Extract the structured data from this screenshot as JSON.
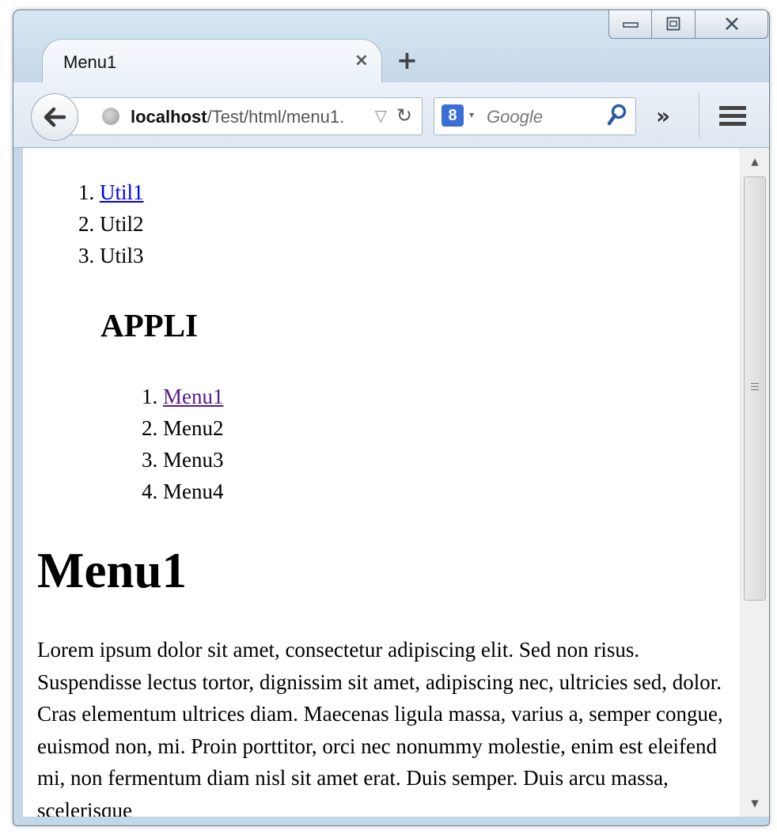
{
  "window": {
    "tab_title": "Menu1",
    "tab_close": "×",
    "new_tab": "+"
  },
  "toolbar": {
    "url_host": "localhost",
    "url_path": "/Test/html/menu1.",
    "url_dropdown": "▽",
    "reload": "↻",
    "search_engine_icon": "8",
    "search_dropdown": "▾",
    "search_placeholder": "Google",
    "overflow": "»"
  },
  "page": {
    "util_list": [
      "Util1",
      "Util2",
      "Util3"
    ],
    "section_heading": "APPLI",
    "menu_list": [
      "Menu1",
      "Menu2",
      "Menu3",
      "Menu4"
    ],
    "title": "Menu1",
    "paragraph": "Lorem ipsum dolor sit amet, consectetur adipiscing elit. Sed non risus. Suspendisse lectus tortor, dignissim sit amet, adipiscing nec, ultricies sed, dolor. Cras elementum ultrices diam. Maecenas ligula massa, varius a, semper congue, euismod non, mi. Proin porttitor, orci nec nonummy molestie, enim est eleifend mi, non fermentum diam nisl sit amet erat. Duis semper. Duis arcu massa, scelerisque"
  },
  "colors": {
    "link": "#0000ee",
    "visited_link": "#551a8b",
    "frame": "#c4d7e8"
  },
  "icons": [
    "minimize-icon",
    "restore-icon",
    "close-icon",
    "back-arrow-icon",
    "globe-icon",
    "search-icon",
    "menu-icon"
  ]
}
